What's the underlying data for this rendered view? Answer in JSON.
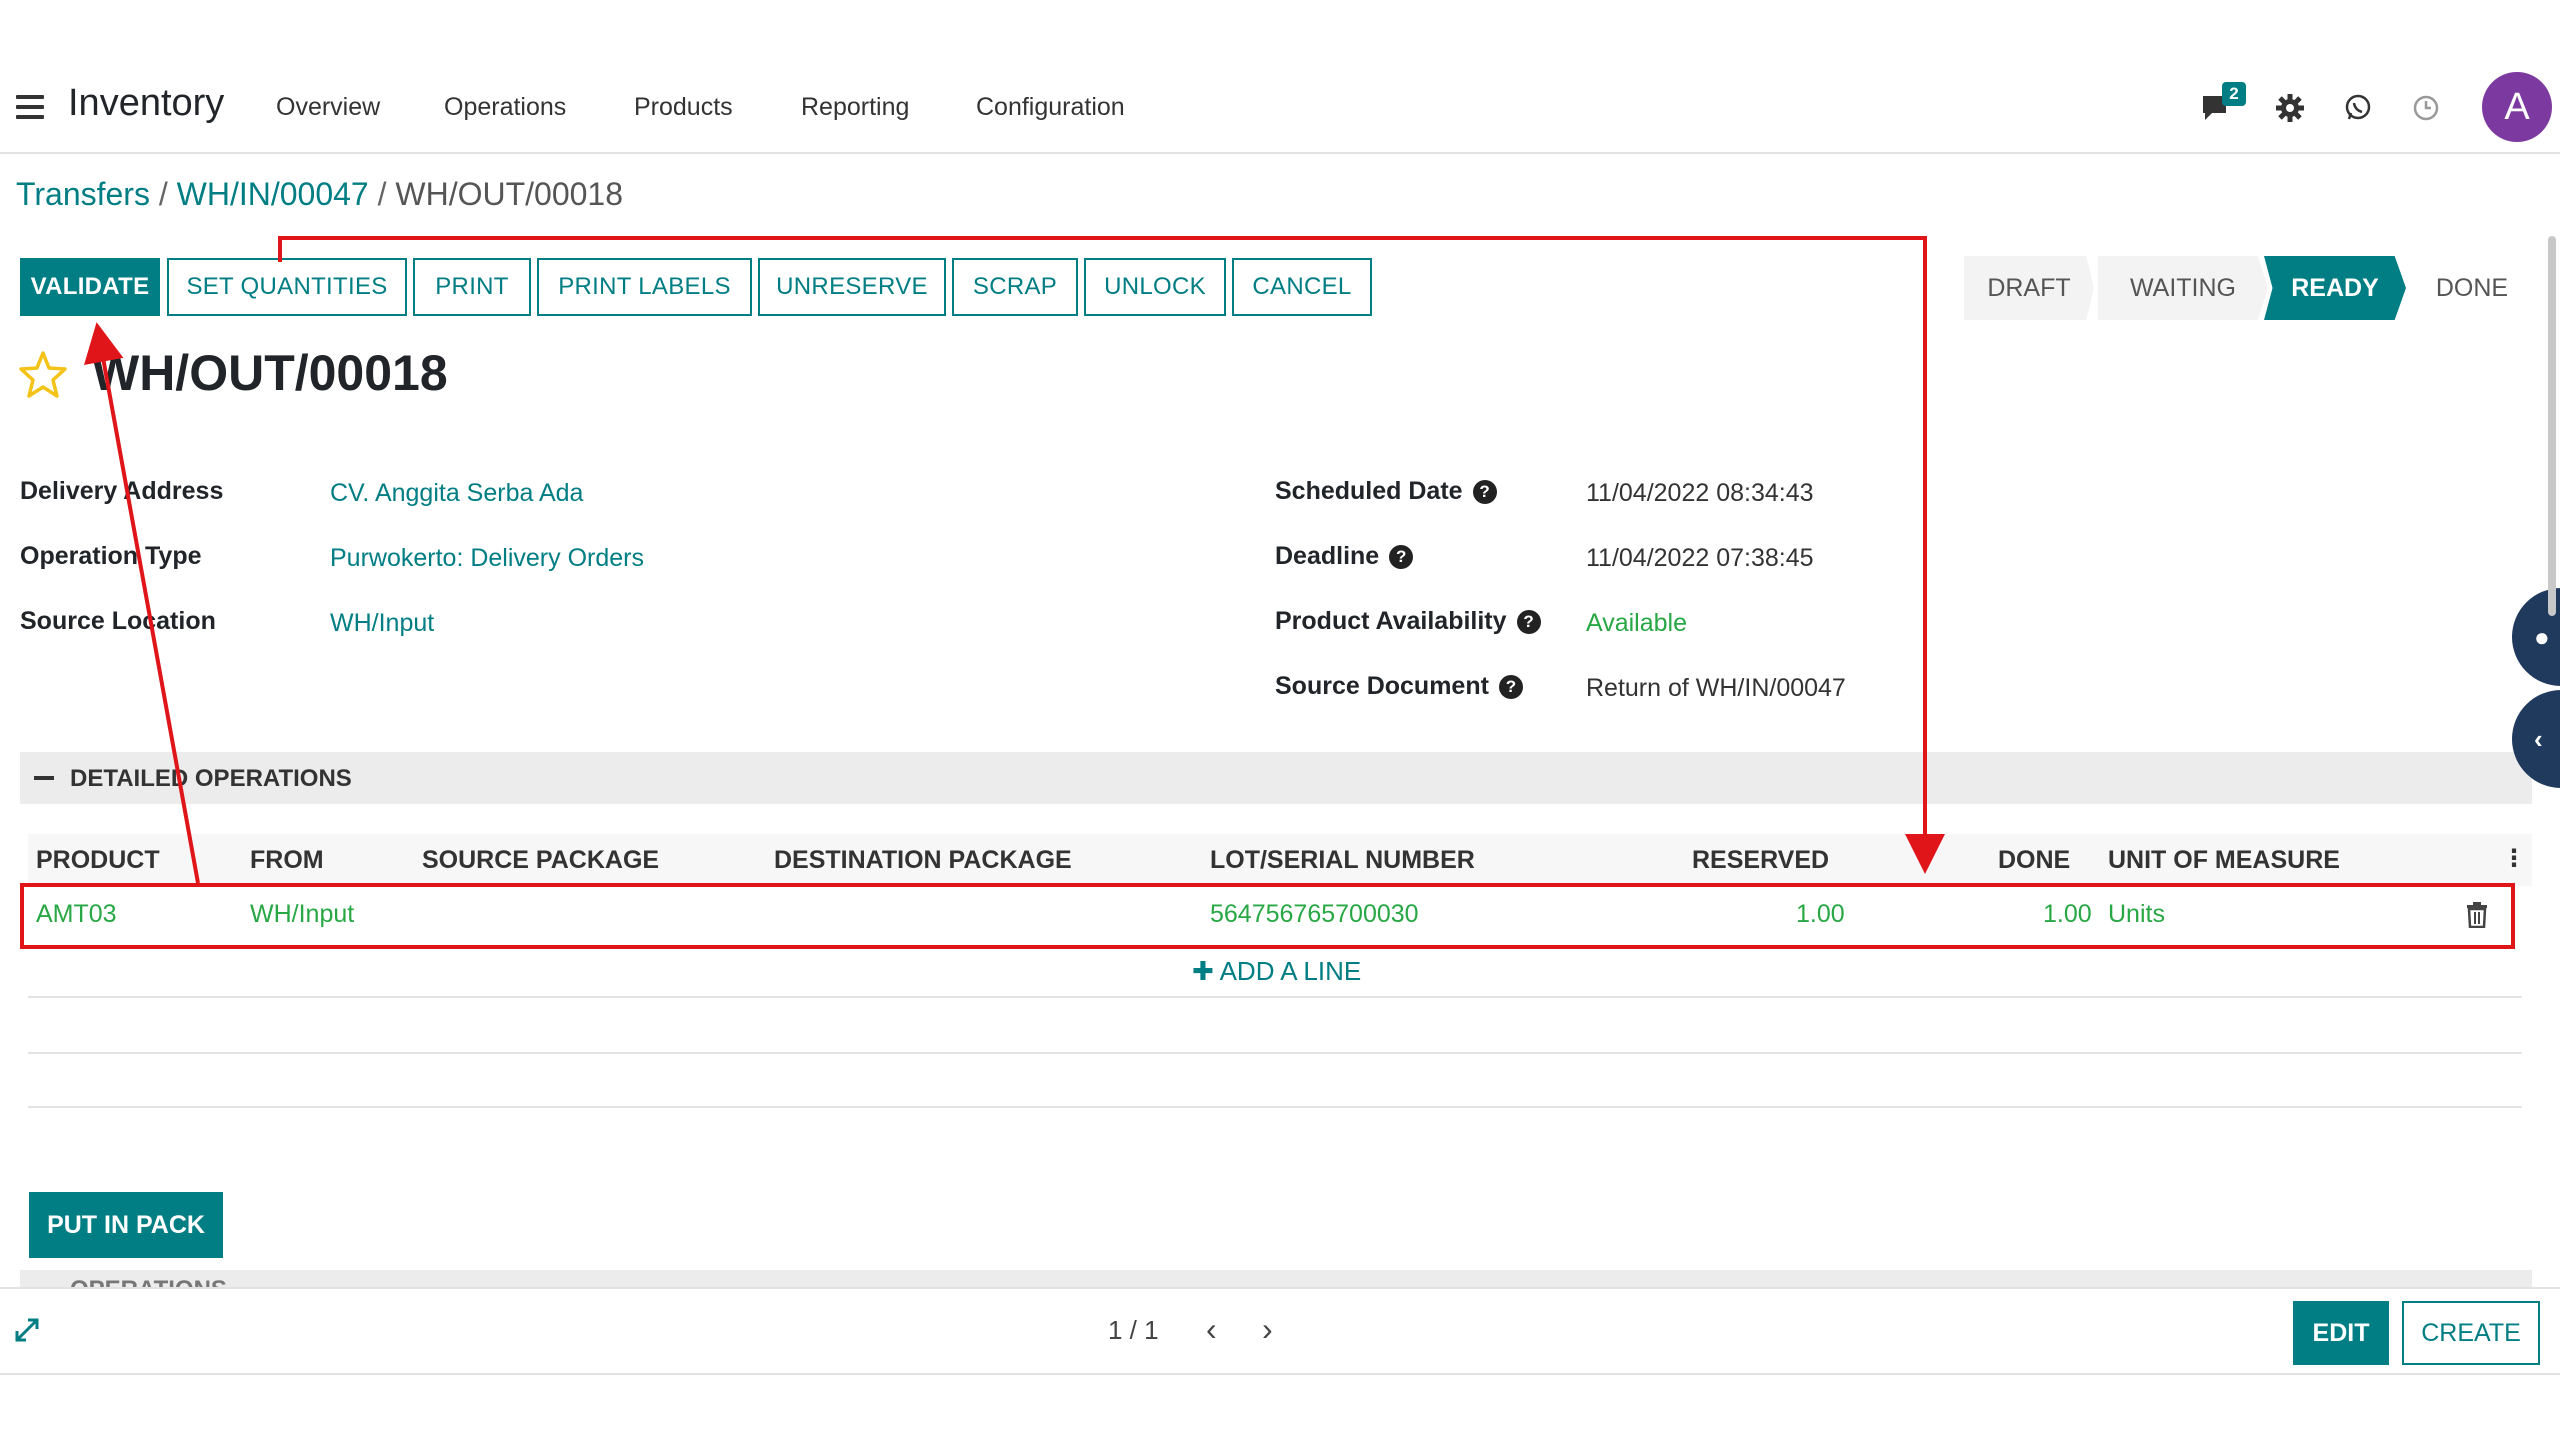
{
  "app": {
    "title": "Inventory"
  },
  "menu": [
    "Overview",
    "Operations",
    "Products",
    "Reporting",
    "Configuration"
  ],
  "systray": {
    "messages_badge": "2",
    "avatar_letter": "A"
  },
  "breadcrumb": {
    "item1": "Transfers",
    "item2": "WH/IN/00047",
    "sep": "/",
    "current": "WH/OUT/00018"
  },
  "actions": {
    "validate": "VALIDATE",
    "set_quantities": "SET QUANTITIES",
    "print": "PRINT",
    "print_labels": "PRINT LABELS",
    "unreserve": "UNRESERVE",
    "scrap": "SCRAP",
    "unlock": "UNLOCK",
    "cancel": "CANCEL"
  },
  "status": {
    "draft": "DRAFT",
    "waiting": "WAITING",
    "ready": "READY",
    "done": "DONE",
    "current": "READY"
  },
  "record": {
    "name": "WH/OUT/00018"
  },
  "fields": {
    "delivery_address": {
      "label": "Delivery Address",
      "value": "CV. Anggita Serba Ada"
    },
    "operation_type": {
      "label": "Operation Type",
      "value": "Purwokerto: Delivery Orders"
    },
    "source_location": {
      "label": "Source Location",
      "value": "WH/Input"
    },
    "scheduled_date": {
      "label": "Scheduled Date",
      "value": "11/04/2022 08:34:43"
    },
    "deadline": {
      "label": "Deadline",
      "value": "11/04/2022 07:38:45"
    },
    "product_availability": {
      "label": "Product Availability",
      "value": "Available"
    },
    "source_document": {
      "label": "Source Document",
      "value": "Return of WH/IN/00047"
    }
  },
  "section": {
    "title": "DETAILED OPERATIONS",
    "next_section_partial": "OPERATIONS"
  },
  "table": {
    "headers": {
      "product": "PRODUCT",
      "from": "FROM",
      "source_package": "SOURCE PACKAGE",
      "destination_package": "DESTINATION PACKAGE",
      "lot": "LOT/SERIAL NUMBER",
      "reserved": "RESERVED",
      "done": "DONE",
      "uom": "UNIT OF MEASURE"
    },
    "rows": [
      {
        "product": "AMT03",
        "from": "WH/Input",
        "source_package": "",
        "destination_package": "",
        "lot": "564756765700030",
        "reserved": "1.00",
        "done": "1.00",
        "uom": "Units"
      }
    ],
    "add_line": "ADD A LINE"
  },
  "put_in_pack": "PUT IN PACK",
  "pager": {
    "value": "1 / 1"
  },
  "footer": {
    "edit": "EDIT",
    "create": "CREATE"
  },
  "icons": {
    "menu": "hamburger-icon",
    "messages": "chat-icon",
    "settings": "gear-icon",
    "whatsapp": "whatsapp-icon",
    "activity": "clock-icon",
    "star": "star-icon",
    "help": "question-circle-icon",
    "delete": "trash-icon",
    "add": "plus-icon",
    "expand": "expand-icon",
    "prev": "chevron-left-icon",
    "next": "chevron-right-icon",
    "side_chat": "chat-icon",
    "side_collapse": "chevron-left-icon"
  },
  "colors": {
    "brand": "#017e84",
    "available": "#28a745",
    "annotation": "#e0151a",
    "avatar": "#7c3aa0",
    "star": "#f3c317"
  }
}
